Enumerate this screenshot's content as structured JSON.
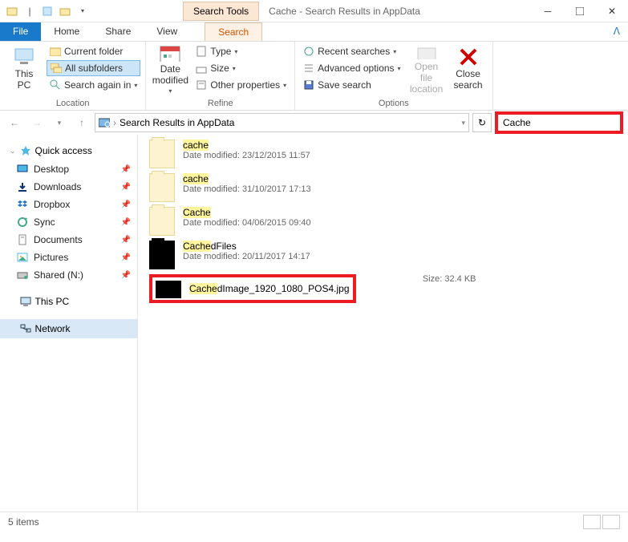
{
  "titlebar": {
    "search_tools": "Search Tools",
    "title": "Cache - Search Results in AppData"
  },
  "tabs": {
    "file": "File",
    "home": "Home",
    "share": "Share",
    "view": "View",
    "search": "Search"
  },
  "ribbon": {
    "this_pc": "This\nPC",
    "current_folder": "Current folder",
    "all_subfolders": "All subfolders",
    "search_again": "Search again in",
    "location_label": "Location",
    "date_modified": "Date\nmodified",
    "type": "Type",
    "size": "Size",
    "other_properties": "Other properties",
    "refine_label": "Refine",
    "recent_searches": "Recent searches",
    "advanced_options": "Advanced options",
    "save_search": "Save search",
    "open_file_location": "Open file\nlocation",
    "close_search": "Close\nsearch",
    "options_label": "Options"
  },
  "nav": {
    "breadcrumb": "Search Results in AppData",
    "search_value": "Cache"
  },
  "sidebar": {
    "quick_access": "Quick access",
    "items": [
      {
        "label": "Desktop"
      },
      {
        "label": "Downloads"
      },
      {
        "label": "Dropbox"
      },
      {
        "label": "Sync"
      },
      {
        "label": "Documents"
      },
      {
        "label": "Pictures"
      },
      {
        "label": "Shared (N:)"
      }
    ],
    "this_pc": "This PC",
    "network": "Network"
  },
  "results": [
    {
      "name_hl": "cache",
      "name_rest": "",
      "meta_label": "Date modified:",
      "meta_val": "23/12/2015 11:57",
      "icon": "folder"
    },
    {
      "name_hl": "cache",
      "name_rest": "",
      "meta_label": "Date modified:",
      "meta_val": "31/10/2017 17:13",
      "icon": "folder"
    },
    {
      "name_hl": "Cache",
      "name_rest": "",
      "meta_label": "Date modified:",
      "meta_val": "04/06/2015 09:40",
      "icon": "folder"
    },
    {
      "name_hl": "Cache",
      "name_rest": "dFiles",
      "meta_label": "Date modified:",
      "meta_val": "20/11/2017 14:17",
      "icon": "dark"
    },
    {
      "name_hl": "Cache",
      "name_rest": "dImage_1920_1080_POS4.jpg",
      "meta_label": "",
      "meta_val": "",
      "icon": "img",
      "size_label": "Size:",
      "size_val": "32.4 KB",
      "boxed": true
    }
  ],
  "status": {
    "count": "5 items"
  }
}
